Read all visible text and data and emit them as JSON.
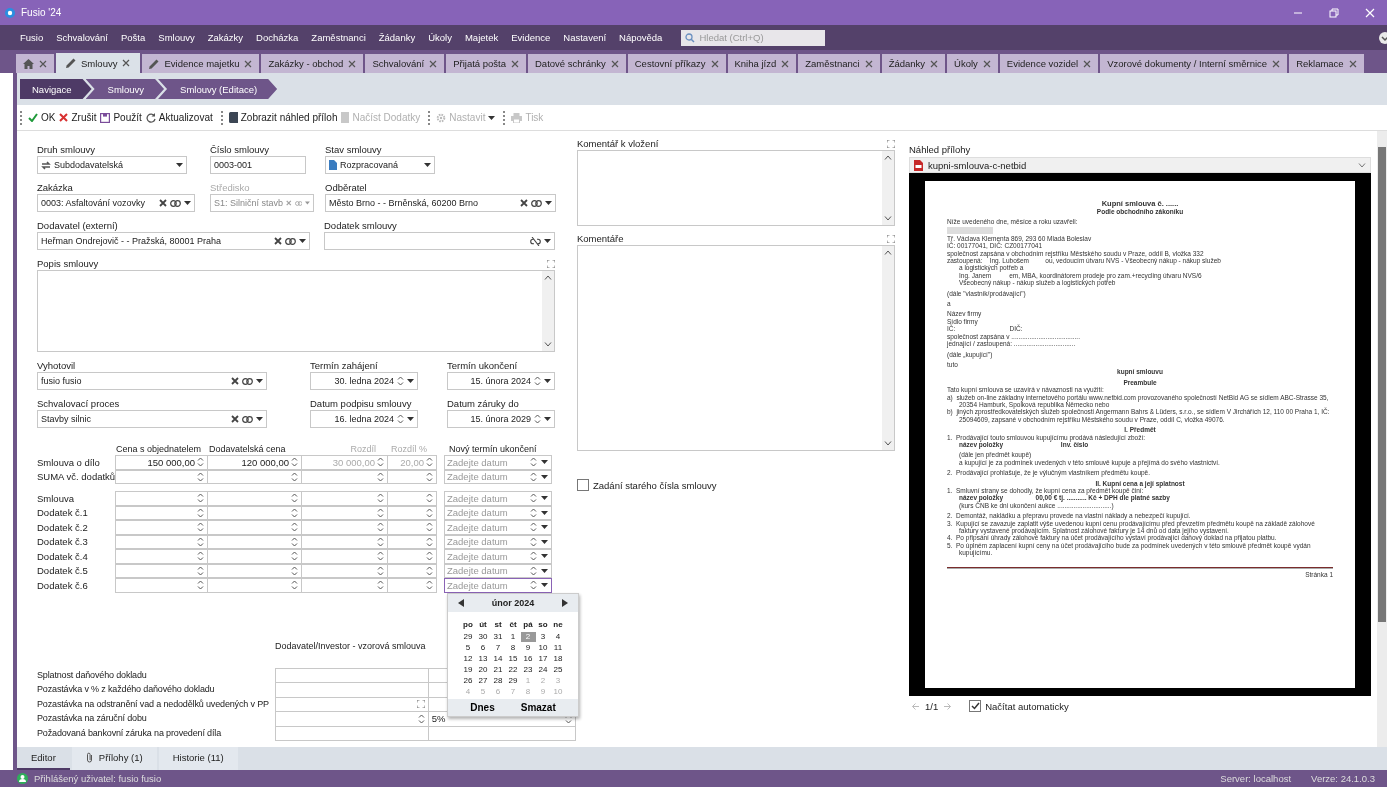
{
  "window": {
    "title": "Fusio '24"
  },
  "menu": [
    "Fusio",
    "Schvalování",
    "Pošta",
    "Smlouvy",
    "Zakázky",
    "Docházka",
    "Zaměstnanci",
    "Žádanky",
    "Úkoly",
    "Majetek",
    "Evidence",
    "Nastavení",
    "Nápověda"
  ],
  "search": {
    "placeholder": "Hledat (Ctrl+Q)"
  },
  "tabs": [
    {
      "kind": "home",
      "selected": false
    },
    {
      "kind": "edit",
      "label": "Smlouvy",
      "selected": true
    },
    {
      "kind": "edit",
      "label": "Evidence majetku",
      "selected": false
    },
    {
      "kind": "plain",
      "label": "Zakázky - obchod",
      "selected": false
    },
    {
      "kind": "plain",
      "label": "Schvalování",
      "selected": false
    },
    {
      "kind": "plain",
      "label": "Přijatá pošta",
      "selected": false
    },
    {
      "kind": "plain",
      "label": "Datové schránky",
      "selected": false
    },
    {
      "kind": "plain",
      "label": "Cestovní příkazy",
      "selected": false
    },
    {
      "kind": "plain",
      "label": "Kniha jízd",
      "selected": false
    },
    {
      "kind": "plain",
      "label": "Zaměstnanci",
      "selected": false
    },
    {
      "kind": "plain",
      "label": "Žádanky",
      "selected": false
    },
    {
      "kind": "plain",
      "label": "Úkoly",
      "selected": false
    },
    {
      "kind": "plain",
      "label": "Evidence vozidel",
      "selected": false
    },
    {
      "kind": "plain",
      "label": "Vzorové dokumenty / Interní směrnice",
      "selected": false
    },
    {
      "kind": "plain",
      "label": "Reklamace",
      "selected": false
    }
  ],
  "breadcrumb": [
    "Navigace",
    "Smlouvy",
    "Smlouvy (Editace)"
  ],
  "toolbar": [
    [
      {
        "kind": "ok",
        "label": "OK",
        "disabled": false
      },
      {
        "kind": "cancel",
        "label": "Zrušit",
        "disabled": false
      },
      {
        "kind": "save",
        "label": "Použít",
        "disabled": false
      },
      {
        "kind": "refresh",
        "label": "Aktualizovat",
        "disabled": false
      }
    ],
    [
      {
        "kind": "book",
        "label": "Zobrazit náhled příloh",
        "disabled": false
      },
      {
        "kind": "load",
        "label": "Načíst Dodatky",
        "disabled": true
      }
    ],
    [
      {
        "kind": "settings",
        "label": "Nastavit",
        "disabled": true
      }
    ],
    [
      {
        "kind": "print",
        "label": "Tisk",
        "disabled": true
      }
    ]
  ],
  "form_rows": [
    [
      {
        "kind": "select",
        "label": "Druh smlouvy",
        "value": "Subdodavatelská",
        "disabled": false
      },
      {
        "kind": "text",
        "label": "Číslo smlouvy",
        "value": "0003-001",
        "disabled": false
      },
      {
        "kind": "select",
        "label": "Stav smlouvy",
        "value": "Rozpracovaná",
        "disabled": false
      }
    ],
    [
      {
        "kind": "lookup",
        "label": "Zakázka",
        "value": "0003: Asfaltování vozovky",
        "disabled": false
      },
      {
        "kind": "lookup",
        "label": "Středisko",
        "value": "S1: Silniční stavb",
        "disabled": true
      },
      {
        "kind": "lookup",
        "label": "Odběratel",
        "value": "Město Brno -  - Brněnská, 60200  Brno",
        "disabled": false
      }
    ],
    [
      {
        "kind": "lookup",
        "label": "Dodavatel (externí)",
        "value": "Heřman Ondrejovič -  - Pražská, 80001  Praha",
        "disabled": false
      },
      {
        "kind": "unlinked",
        "label": "Dodatek smlouvy",
        "disabled": false
      }
    ],
    [
      {
        "kind": "memo",
        "label": "Popis smlouvy",
        "disabled": false
      }
    ],
    [
      {
        "kind": "lookup",
        "label": "Vyhotovil",
        "value": "fusio fusio",
        "disabled": false
      },
      {
        "kind": "date",
        "label": "Termín zahájení",
        "value": "30. ledna 2024",
        "disabled": false
      },
      {
        "kind": "date",
        "label": "Termín ukončení",
        "value": "15. února 2024",
        "disabled": false
      }
    ],
    [
      {
        "kind": "lookup",
        "label": "Schvalovací proces",
        "value": "Stavby silnic",
        "disabled": false
      },
      {
        "kind": "date",
        "label": "Datum podpisu smlouvy",
        "value": "16. ledna 2024",
        "disabled": false
      },
      {
        "kind": "date",
        "label": "Datum záruky do",
        "value": "15. února 2029",
        "disabled": false
      }
    ]
  ],
  "price_table": {
    "columns": [
      {
        "label": "Cena s objednatelem",
        "disabled": false
      },
      {
        "label": "Dodavatelská cena",
        "disabled": false
      },
      {
        "label": "Rozdíl",
        "disabled": true
      },
      {
        "label": "Rozdíl %",
        "disabled": true
      },
      {
        "label": "Nový termín ukončení",
        "disabled": false
      }
    ],
    "groups": [
      [
        {
          "label": "Smlouva o dílo",
          "cells": [
            "150 000,00",
            "120 000,00",
            "30 000,00",
            "20,00"
          ],
          "date_placeholder": "Zadejte datum",
          "focused": false
        },
        {
          "label": "SUMA vč. dodatků",
          "date_placeholder": "Zadejte datum",
          "focused": false
        }
      ],
      [
        {
          "label": "Smlouva",
          "date_placeholder": "Zadejte datum",
          "focused": false
        },
        {
          "label": "Dodatek č.1",
          "date_placeholder": "Zadejte datum",
          "focused": false
        },
        {
          "label": "Dodatek č.2",
          "date_placeholder": "Zadejte datum",
          "focused": false
        },
        {
          "label": "Dodatek č.3",
          "date_placeholder": "Zadejte datum",
          "focused": false
        },
        {
          "label": "Dodatek č.4",
          "date_placeholder": "Zadejte datum",
          "focused": false
        },
        {
          "label": "Dodatek č.5",
          "date_placeholder": "Zadejte datum",
          "focused": false
        },
        {
          "label": "Dodatek č.6",
          "date_placeholder": "Zadejte datum",
          "focused": true
        }
      ]
    ]
  },
  "calendar": {
    "month": "únor 2024",
    "weekdays": [
      "po",
      "út",
      "st",
      "čt",
      "pá",
      "so",
      "ne"
    ],
    "weeks": [
      [
        {
          "d": "29",
          "muted": false,
          "selected": false
        },
        {
          "d": "30",
          "muted": false,
          "selected": false
        },
        {
          "d": "31",
          "muted": false,
          "selected": false
        },
        {
          "d": "1",
          "muted": false,
          "selected": false
        },
        {
          "d": "2",
          "muted": false,
          "selected": true
        },
        {
          "d": "3",
          "muted": false,
          "selected": false
        },
        {
          "d": "4",
          "muted": false,
          "selected": false
        }
      ],
      [
        {
          "d": "5",
          "muted": false,
          "selected": false
        },
        {
          "d": "6",
          "muted": false,
          "selected": false
        },
        {
          "d": "7",
          "muted": false,
          "selected": false
        },
        {
          "d": "8",
          "muted": false,
          "selected": false
        },
        {
          "d": "9",
          "muted": false,
          "selected": false
        },
        {
          "d": "10",
          "muted": false,
          "selected": false
        },
        {
          "d": "11",
          "muted": false,
          "selected": false
        }
      ],
      [
        {
          "d": "12",
          "muted": false,
          "selected": false
        },
        {
          "d": "13",
          "muted": false,
          "selected": false
        },
        {
          "d": "14",
          "muted": false,
          "selected": false
        },
        {
          "d": "15",
          "muted": false,
          "selected": false
        },
        {
          "d": "16",
          "muted": false,
          "selected": false
        },
        {
          "d": "17",
          "muted": false,
          "selected": false
        },
        {
          "d": "18",
          "muted": false,
          "selected": false
        }
      ],
      [
        {
          "d": "19",
          "muted": false,
          "selected": false
        },
        {
          "d": "20",
          "muted": false,
          "selected": false
        },
        {
          "d": "21",
          "muted": false,
          "selected": false
        },
        {
          "d": "22",
          "muted": false,
          "selected": false
        },
        {
          "d": "23",
          "muted": false,
          "selected": false
        },
        {
          "d": "24",
          "muted": false,
          "selected": false
        },
        {
          "d": "25",
          "muted": false,
          "selected": false
        }
      ],
      [
        {
          "d": "26",
          "muted": false,
          "selected": false
        },
        {
          "d": "27",
          "muted": false,
          "selected": false
        },
        {
          "d": "28",
          "muted": false,
          "selected": false
        },
        {
          "d": "29",
          "muted": false,
          "selected": false
        },
        {
          "d": "1",
          "muted": true,
          "selected": false
        },
        {
          "d": "2",
          "muted": true,
          "selected": false
        },
        {
          "d": "3",
          "muted": true,
          "selected": false
        }
      ],
      [
        {
          "d": "4",
          "muted": true,
          "selected": false
        },
        {
          "d": "5",
          "muted": true,
          "selected": false
        },
        {
          "d": "6",
          "muted": true,
          "selected": false
        },
        {
          "d": "7",
          "muted": true,
          "selected": false
        },
        {
          "d": "8",
          "muted": true,
          "selected": false
        },
        {
          "d": "9",
          "muted": true,
          "selected": false
        },
        {
          "d": "10",
          "muted": true,
          "selected": false
        }
      ]
    ],
    "buttons": [
      "Dnes",
      "Smazat"
    ]
  },
  "terms": {
    "heading": "Dodavatel/Investor - vzorová smlouva",
    "rows": [
      {
        "kind": "plain",
        "label": "Splatnost daňového dokladu"
      },
      {
        "kind": "plain",
        "label": "Pozastávka v % z každého daňového dokladu"
      },
      {
        "kind": "expand",
        "label": "Pozastávka na odstranění vad a nedodělků uvedených v PP"
      },
      {
        "kind": "spin",
        "label": "Pozastávka na záruční dobu",
        "value": "5%"
      },
      {
        "kind": "plain",
        "label": "Požadovaná bankovní záruka na provedení díla"
      }
    ]
  },
  "comments": [
    {
      "label": "Komentář k vložení"
    },
    {
      "label": "Komentáře"
    }
  ],
  "old_number": {
    "label": "Zadání starého čísla smlouvy",
    "checked": false
  },
  "preview": {
    "label": "Náhled přílohy",
    "file": "kupni-smlouva-c-netbid",
    "pager": "1/1",
    "auto_load": {
      "label": "Načítat automaticky",
      "checked": true
    },
    "document": [
      {
        "kind": "title",
        "text": "Kupní smlouva č. ......"
      },
      {
        "kind": "subtitle",
        "text": "Podle obchodního zákoníku"
      },
      {
        "kind": "gap"
      },
      {
        "kind": "text",
        "text": "Níže uvedeného dne, měsíce a roku uzavřeli:"
      },
      {
        "kind": "redacted"
      },
      {
        "kind": "text",
        "text": "Tř. Václava Klementa 869, 293 60 Mladá Boleslav"
      },
      {
        "kind": "text",
        "text": "IČ: 00177041, DIČ: CZ00177041"
      },
      {
        "kind": "text",
        "text": "společnost zapsána v obchodním rejstříku Městského soudu v Praze, oddíl B, vložka 332"
      },
      {
        "kind": "text",
        "text": "zastoupená:    Ing. Lubošem         ou, vedoucím útvaru NVS - Všeobecný nákup - nákup služeb"
      },
      {
        "kind": "indent",
        "text": "a logistických potřeb a"
      },
      {
        "kind": "indent",
        "text": "Ing. Janem          em, MBA, koordinátorem prodeje pro zam.+recycling útvaru NVS/6"
      },
      {
        "kind": "indent",
        "text": "Všeobecný nákup - nákup služeb a logistických potřeb"
      },
      {
        "kind": "gap"
      },
      {
        "kind": "text",
        "text": "(dále \"vlastník/prodávající\")"
      },
      {
        "kind": "gap"
      },
      {
        "kind": "text",
        "text": "a"
      },
      {
        "kind": "gap"
      },
      {
        "kind": "text",
        "text": "Název firmy"
      },
      {
        "kind": "text",
        "text": "Sídlo firmy"
      },
      {
        "kind": "text",
        "text": "IČ:                              DIČ:"
      },
      {
        "kind": "text",
        "text": "společnost zapsána v ......................................"
      },
      {
        "kind": "text",
        "text": "jednající / zastoupená: .................................."
      },
      {
        "kind": "gap"
      },
      {
        "kind": "text",
        "text": "(dále „kupující\")"
      },
      {
        "kind": "gap"
      },
      {
        "kind": "text",
        "text": "tuto"
      },
      {
        "kind": "heading",
        "text": "kupní smlouvu"
      },
      {
        "kind": "gap"
      },
      {
        "kind": "heading",
        "text": "Preambule"
      },
      {
        "kind": "text",
        "text": "Tato kupní smlouva se uzavírá v návaznosti na využití:"
      },
      {
        "kind": "item",
        "text": "a)  služeb on-line základny internetového portálu www.netbid.com provozovaného společností NetBid AG se sídlem ABC-Strasse 35, 20354 Hamburk, Spolková republika Německo nebo"
      },
      {
        "kind": "item",
        "text": "b)  jiných zprostředkovatelských služeb společnosti Angermann Bahrs & Lüders, s.r.o., se sídlem V Jirchářích 12, 110 00 Praha 1, IČ: 25094609, zapsané v obchodním rejstříku Městského soudu v Praze, oddíl C, vložka 49076."
      },
      {
        "kind": "gap"
      },
      {
        "kind": "heading",
        "text": "I. Předmět"
      },
      {
        "kind": "item",
        "text": "1.  Prodávající touto smlouvou kupujícímu prodává následující zboží:"
      },
      {
        "kind": "bold",
        "text": "název položky                                Inv. číslo"
      },
      {
        "kind": "gap"
      },
      {
        "kind": "indent",
        "text": "(dále jen předmět koupě)"
      },
      {
        "kind": "indent",
        "text": "a kupující je za podmínek uvedených v této smlouvě kupuje a přejímá do svého vlastnictví."
      },
      {
        "kind": "gap"
      },
      {
        "kind": "item",
        "text": "2.  Prodávající prohlašuje, že je výlučným vlastníkem předmětu koupě."
      },
      {
        "kind": "gap"
      },
      {
        "kind": "heading",
        "text": "II. Kupní cena a její splatnost"
      },
      {
        "kind": "item",
        "text": "1.  Smluvní strany se dohodly, že kupní cena za předmět koupě činí:"
      },
      {
        "kind": "bold",
        "text": "název položky                  00,00 € tj. ........... Kč + DPH dle platné sazby"
      },
      {
        "kind": "indent",
        "text": "(kurs ČNB ke dni ukončení aukce ..............................)"
      },
      {
        "kind": "gap"
      },
      {
        "kind": "item",
        "text": "2.  Demontáž, nakládku a přepravu provede na vlastní náklady a nebezpečí kupující."
      },
      {
        "kind": "item",
        "text": "3.  Kupující se zavazuje zaplatit výše uvedenou kupní cenu prodávajícímu před převzetím předmětu koupě na základě zálohové faktury vystavené prodávajícím. Splatnost zálohové faktury je 14 dnů od data jejího vystavení."
      },
      {
        "kind": "item",
        "text": "4.  Po připsání úhrady zálohové faktury na účet prodávajícího vystaví prodávající daňový doklad na přijatou platbu."
      },
      {
        "kind": "item",
        "text": "5.  Po úplném zaplacení kupní ceny na účet prodávajícího bude za podmínek uvedených v této smlouvě předmět koupě vydán kupujícímu."
      },
      {
        "kind": "footer",
        "text": "Stránka 1"
      }
    ]
  },
  "bottom_tabs": [
    {
      "kind": "plain",
      "label": "Editor",
      "selected": true
    },
    {
      "kind": "attach",
      "label": "Přílohy (1)",
      "selected": false
    },
    {
      "kind": "plain",
      "label": "Historie (11)",
      "selected": false
    }
  ],
  "status_bar": {
    "user": "Přihlášený uživatel: fusio fusio",
    "server": "Server: localhost",
    "version": "Verze: 24.1.0.3"
  }
}
